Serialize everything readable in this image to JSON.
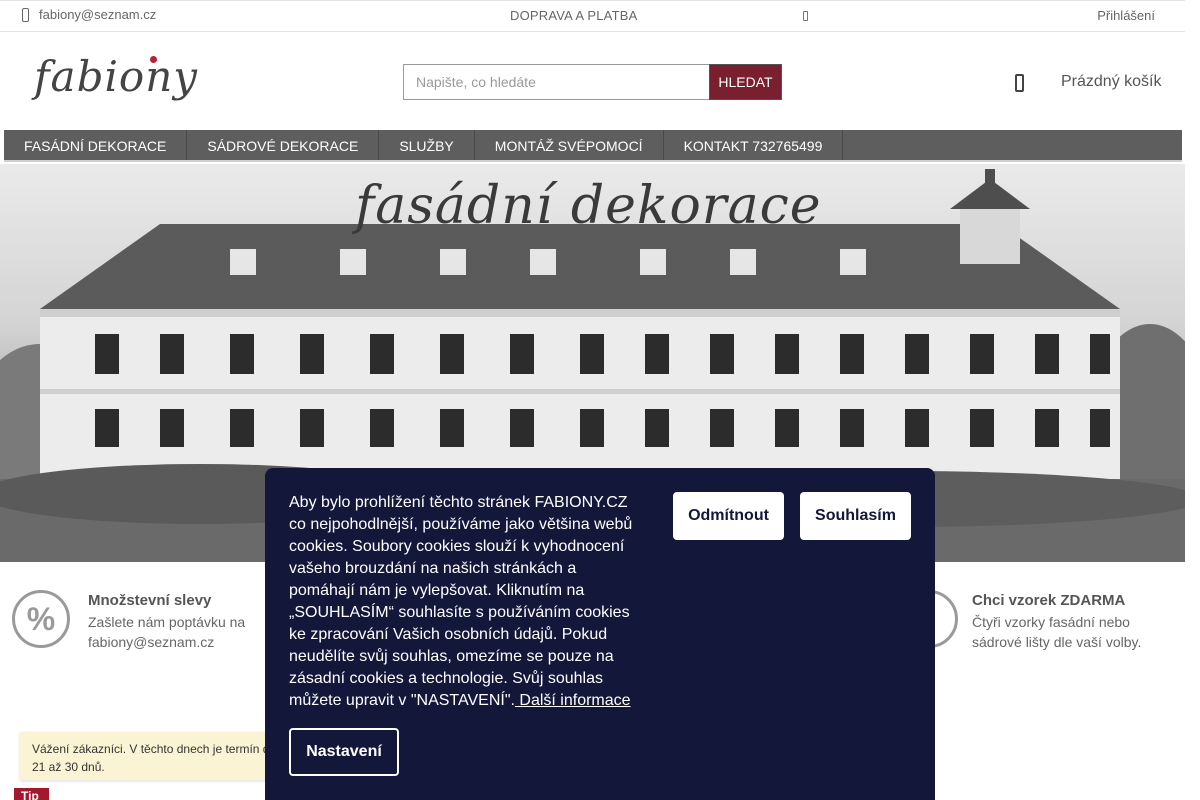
{
  "topbar": {
    "email": "fabiony@seznam.cz",
    "shipping": "DOPRAVA A PLATBA",
    "login": "Přihlášení"
  },
  "header": {
    "logo": "fabiony",
    "search_placeholder": "Napište, co hledáte",
    "search_button": "HLEDAT",
    "cart": "Prázdný košík"
  },
  "nav": {
    "items": [
      "FASÁDNÍ DEKORACE",
      "SÁDROVÉ DEKORACE",
      "SLUŽBY",
      "MONTÁŽ SVÉPOMOCÍ",
      "KONTAKT 732765499"
    ]
  },
  "hero": {
    "title": "fasádní dekorace"
  },
  "features": {
    "discount": {
      "title": "Množstevní slevy",
      "line1": "Zašlete nám poptávku na",
      "line2": "fabiony@seznam.cz"
    },
    "sample": {
      "title": "Chci vzorek ZDARMA",
      "line1": "Čtyři vzorky fasádní nebo",
      "line2": "sádrové lišty dle vaší volby."
    }
  },
  "notice": {
    "line1": "Vážení zákazníci. V těchto dnech je termín d",
    "line2": "21 až 30 dnů."
  },
  "tip": "Tip",
  "cookie": {
    "text": "Aby bylo prohlížení těchto stránek FABIONY.CZ co nejpohodlnější, používáme jako většina webů cookies. Soubory cookies slouží k vyhodnocení vašeho brouzdání na našich stránkách a pomáhají nám je vylepšovat. Kliknutím na „SOUHLASÍM“ souhlasíte s používáním cookies ke zpracování Vašich osobních údajů. Pokud neudělíte svůj souhlas, omezíme se pouze na zásadní cookies a technologie. Svůj souhlas můžete upravit v \"NASTAVENÍ\".",
    "link": " Další informace",
    "reject": "Odmítnout",
    "accept": "Souhlasím",
    "settings": "Nastavení"
  },
  "colors": {
    "brand": "#7a1f2e",
    "nav_bg": "#5e5e5e",
    "cookie_bg": "#13173a",
    "tip_badge": "#a3182d",
    "notice_bg": "#fbf4d4"
  }
}
